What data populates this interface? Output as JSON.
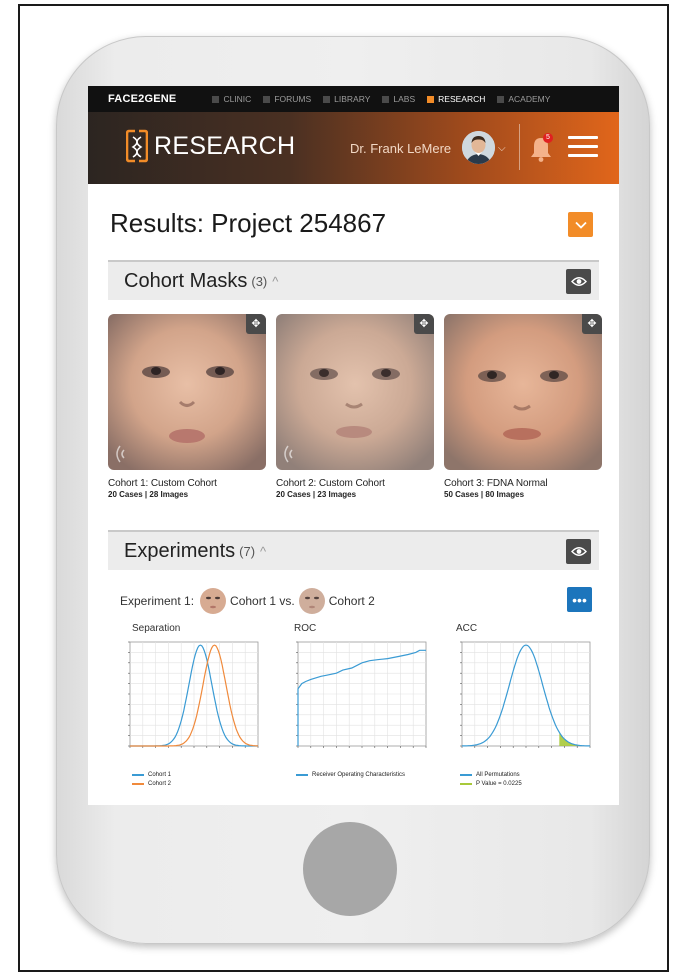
{
  "nav": {
    "brand": "FACE2GENE",
    "items": [
      {
        "label": "CLINIC",
        "active": false
      },
      {
        "label": "FORUMS",
        "active": false
      },
      {
        "label": "LIBRARY",
        "active": false
      },
      {
        "label": "LABS",
        "active": false
      },
      {
        "label": "RESEARCH",
        "active": true
      },
      {
        "label": "ACADEMY",
        "active": false
      }
    ]
  },
  "header": {
    "logo_text": "RESEARCH",
    "doctor_name": "Dr. Frank LeMere",
    "notification_count": "5",
    "icons": [
      "face2gene-logo-icon",
      "avatar",
      "chevron-down-icon",
      "bell-icon",
      "hamburger-menu-icon"
    ]
  },
  "page": {
    "title": "Results: Project 254867"
  },
  "cohort_masks": {
    "label": "Cohort Masks",
    "count": "(3)",
    "cards": [
      {
        "name": "Cohort 1: Custom Cohort",
        "meta": "20 Cases | 28 Images"
      },
      {
        "name": "Cohort 2: Custom Cohort",
        "meta": "20 Cases | 23 Images"
      },
      {
        "name": "Cohort 3: FDNA Normal",
        "meta": "50 Cases | 80 Images"
      }
    ]
  },
  "experiments": {
    "label": "Experiments",
    "count": "(7)",
    "exp1": {
      "prefix": "Experiment 1:",
      "cohort_a": "Cohort 1 vs.",
      "cohort_b": "Cohort 2"
    }
  },
  "colors": {
    "accent_orange": "#f28c28",
    "button_blue": "#1c75bc",
    "series_blue": "#3a9bd4",
    "series_orange": "#f08a3c",
    "series_green": "#a8c93a"
  },
  "chart_data": [
    {
      "type": "line",
      "title": "Separation",
      "xlim": [
        0,
        1
      ],
      "ylim": [
        0,
        1
      ],
      "grid": true,
      "series": [
        {
          "name": "Cohort 1",
          "mean": 0.55,
          "sd": 0.09,
          "color": "#3a9bd4"
        },
        {
          "name": "Cohort 2",
          "mean": 0.66,
          "sd": 0.09,
          "color": "#f08a3c"
        }
      ],
      "legend": "bottom-left"
    },
    {
      "type": "line",
      "title": "ROC",
      "xlim": [
        0,
        1
      ],
      "ylim": [
        0,
        1
      ],
      "grid": true,
      "series": [
        {
          "name": "Receiver Operating Characteristics",
          "color": "#3a9bd4",
          "x": [
            0,
            0.0,
            0.03,
            0.06,
            0.1,
            0.18,
            0.22,
            0.3,
            0.35,
            0.42,
            0.5,
            0.56,
            0.62,
            0.7,
            0.78,
            0.86,
            0.92,
            0.95,
            1.0
          ],
          "y": [
            0,
            0.55,
            0.6,
            0.62,
            0.64,
            0.67,
            0.68,
            0.7,
            0.73,
            0.75,
            0.8,
            0.82,
            0.83,
            0.84,
            0.86,
            0.88,
            0.9,
            0.92,
            0.92
          ]
        }
      ],
      "legend": "bottom-left"
    },
    {
      "type": "line",
      "title": "ACC",
      "xlim": [
        0,
        1
      ],
      "ylim": [
        0,
        1
      ],
      "grid": true,
      "series": [
        {
          "name": "All Permutations",
          "mean": 0.5,
          "sd": 0.13,
          "color": "#3a9bd4"
        },
        {
          "name": "P Value = 0.0225",
          "threshold": 0.76,
          "color": "#a8c93a"
        }
      ],
      "legend": "bottom-left"
    }
  ]
}
